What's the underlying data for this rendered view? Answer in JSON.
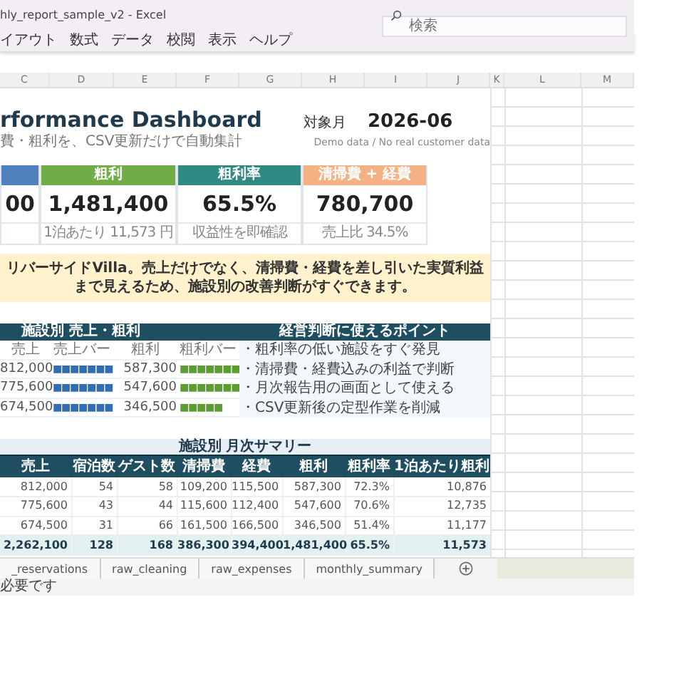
{
  "window": {
    "title": "hly_report_sample_v2  -  Excel"
  },
  "search": {
    "placeholder": "検索"
  },
  "menu": [
    "イアウト",
    "数式",
    "データ",
    "校閲",
    "表示",
    "ヘルプ"
  ],
  "columns": [
    "C",
    "D",
    "E",
    "F",
    "G",
    "H",
    "I",
    "J",
    "K",
    "L",
    "M"
  ],
  "dashboard": {
    "title": "rformance Dashboard",
    "month_label": "対象月",
    "month": "2026-06",
    "subtitle": "費・粗利を、CSV更新だけで自動集計",
    "note": "Demo data / No real customer data"
  },
  "kpis": [
    {
      "value": "00",
      "color": "#4f81bd"
    },
    {
      "label": "粗利",
      "value": "1,481,400",
      "sub": "1泊あたり 11,573 円",
      "color": "#70ad47"
    },
    {
      "label": "粗利率",
      "value": "65.5%",
      "sub": "収益性を即確認",
      "color": "#2f8a84"
    },
    {
      "label": "清掃費 + 経費",
      "value": "780,700",
      "sub": "売上比 34.5%",
      "color": "#f4b183"
    }
  ],
  "banner": "リバーサイドVilla。売上だけでなく、清掃費・経費を差し引いた実質利益まで見えるため、施設別の改善判断がすぐできます。",
  "facility_chart": {
    "title": "施設別 売上・粗利",
    "columns": [
      "売上",
      "売上バー",
      "粗利",
      "粗利バー"
    ],
    "rows": [
      {
        "sales": "812,000",
        "sales_bar": "■■■■■■■",
        "profit": "587,300",
        "profit_bar": "■■■■■■■"
      },
      {
        "sales": "775,600",
        "sales_bar": "■■■■■■■",
        "profit": "547,600",
        "profit_bar": "■■■■■■■"
      },
      {
        "sales": "674,500",
        "sales_bar": "■■■■■■■",
        "profit": "346,500",
        "profit_bar": "■■■■■"
      }
    ]
  },
  "points": {
    "title": "経営判断に使えるポイント",
    "items": [
      "・粗利率の低い施設をすぐ発見",
      "・清掃費・経費込みの利益で判断",
      "・月次報告用の画面として使える",
      "・CSV更新後の定型作業を削減"
    ]
  },
  "summary": {
    "title": "施設別 月次サマリー",
    "columns": [
      "売上",
      "宿泊数",
      "ゲスト数",
      "清掃費",
      "経費",
      "粗利",
      "粗利率",
      "1泊あたり粗利"
    ],
    "rows": [
      [
        "812,000",
        "54",
        "58",
        "109,200",
        "115,500",
        "587,300",
        "72.3%",
        "10,876"
      ],
      [
        "775,600",
        "43",
        "44",
        "115,600",
        "112,400",
        "547,600",
        "70.6%",
        "12,735"
      ],
      [
        "674,500",
        "31",
        "66",
        "161,500",
        "166,500",
        "346,500",
        "51.4%",
        "11,177"
      ]
    ],
    "total": [
      "2,262,100",
      "128",
      "168",
      "386,300",
      "394,400",
      "1,481,400",
      "65.5%",
      "11,573"
    ]
  },
  "sheet_tabs": [
    {
      "label": "_reservations",
      "selected": false
    },
    {
      "label": "raw_cleaning",
      "selected": false
    },
    {
      "label": "raw_expenses",
      "selected": false
    },
    {
      "label": "monthly_summary",
      "selected": false
    }
  ],
  "status_bar": "必要です"
}
